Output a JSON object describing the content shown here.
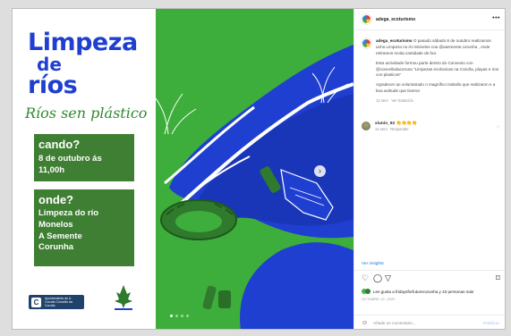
{
  "poster": {
    "title_line1": "Limpeza",
    "title_line2": "de",
    "title_line3": "ríos",
    "subtitle": "Ríos sen plástico",
    "when_head": "cando?",
    "when_body": "8 de outubro ás 11,00h",
    "where_head": "onde?",
    "where_body_1": "Limpeza do río",
    "where_body_2": "Monelos",
    "where_body_3": "A Semente",
    "where_body_4": "Corunha",
    "logo_left_text": "Ayuntamiento de A Coruña Concello da Coruña",
    "colors": {
      "title": "#1f3fd0",
      "box": "#3f7f33",
      "river": "#1f3fd0",
      "grass": "#3dae3b"
    }
  },
  "post": {
    "username": "adega_ecoturismo",
    "more_icon": "ellipsis-icon",
    "caption_user": "adega_ecoturismo",
    "caption_p1": "O pasado sábado 8 de outubro realizamos unha Limpeza no río Monelos coa @asemente.corunha , onde retiramos moita cantidade de lixo",
    "caption_p2": "Esta actividade formou parte dentro do Convenio con @concellodacoruna \"Limpezas ecoloxicas na Coruña, playas e rios con plasticos\"",
    "caption_p3": "Agradecer ao voluntariado o magnífico traballo que realizaron e a boa actitude que tiveron",
    "caption_meta_time": "12 sem",
    "caption_meta_action": "Ver tradución",
    "comment_user": "xiunin_92",
    "comment_emoji": "👏👏👏👏",
    "comment_meta_time": "12 sem",
    "comment_meta_action": "Responder",
    "insights": "Ver insights",
    "likes_text": "Les gusta a fridaysforfuturecorunha y 43 personas más",
    "date": "OCTUBRE 12, 2022",
    "add_comment_placeholder": "Añade un comentario...",
    "publish": "Publicar"
  }
}
